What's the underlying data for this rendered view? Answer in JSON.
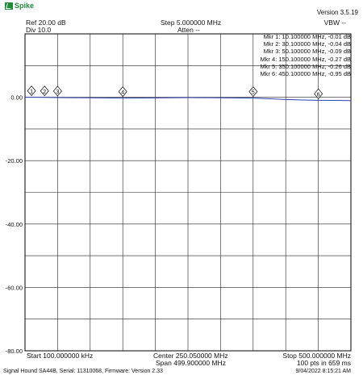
{
  "app": {
    "name": "Spike",
    "version": "Version 3.5.19"
  },
  "header": {
    "ref_level": "Ref 20.00 dB",
    "div": "Div 10.0",
    "step": "Step 5.000000 MHz",
    "atten": "Atten --",
    "vbw": "VBW --"
  },
  "markers": [
    {
      "id": "1",
      "freq_mhz": 10.1,
      "value_db": -0.01,
      "readout": "Mkr 1: 10.100000 MHz, -0.01 dB"
    },
    {
      "id": "2",
      "freq_mhz": 30.1,
      "value_db": -0.04,
      "readout": "Mkr 2: 30.100000 MHz, -0.04 dB"
    },
    {
      "id": "3",
      "freq_mhz": 50.1,
      "value_db": -0.09,
      "readout": "Mkr 3: 50.100000 MHz, -0.09 dB"
    },
    {
      "id": "4",
      "freq_mhz": 150.1,
      "value_db": -0.27,
      "readout": "Mkr 4: 150.100000 MHz, -0.27 dB"
    },
    {
      "id": "5",
      "freq_mhz": 350.1,
      "value_db": -0.26,
      "readout": "Mkr 5: 350.100000 MHz, -0.26 dB"
    },
    {
      "id": "6",
      "freq_mhz": 450.1,
      "value_db": -0.95,
      "readout": "Mkr 6: 450.100000 MHz, -0.95 dB"
    }
  ],
  "footer": {
    "start": "Start 100.000000 kHz",
    "center": "Center 250.050000 MHz",
    "span": "Span 499.900000 MHz",
    "stop": "Stop 500.000000 MHz",
    "points": "100 pts in 659 ms",
    "device": "Signal Hound SA44B, Serial: 11310068, Firmware: Version 2.33",
    "timestamp": "9/04/2022 8:15:21 AM"
  },
  "chart_data": {
    "type": "line",
    "x_range_mhz": [
      0.1,
      500.0
    ],
    "y_range_db": [
      -80,
      20
    ],
    "y_ticks": [
      "0.00",
      "-20.00",
      "-40.00",
      "-60.00",
      "-80.00"
    ],
    "y_tick_values": [
      0,
      -20,
      -40,
      -60,
      -80
    ],
    "grid": true,
    "trace_color": "#2f3fae",
    "series": [
      {
        "x": [
          0.1,
          10.1,
          30.1,
          50.1,
          100,
          150.1,
          200,
          250,
          300,
          350.1,
          380,
          400,
          425,
          450.1,
          475,
          500
        ],
        "y": [
          0.0,
          -0.01,
          -0.04,
          -0.09,
          -0.15,
          -0.27,
          -0.2,
          -0.1,
          -0.15,
          -0.26,
          -0.5,
          -0.7,
          -0.85,
          -0.95,
          -1.0,
          -1.05
        ]
      }
    ]
  }
}
